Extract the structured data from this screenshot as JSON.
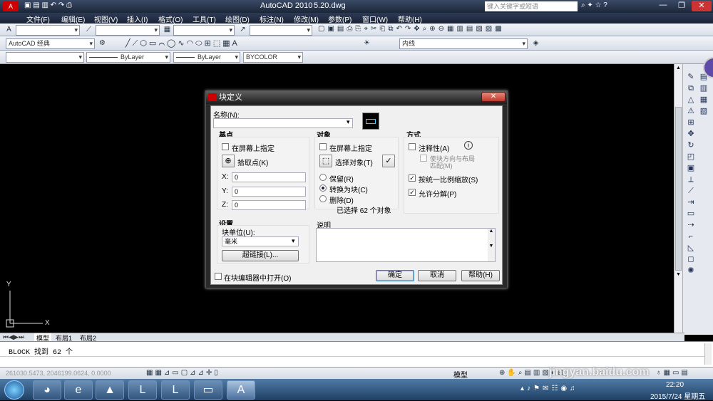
{
  "titlebar": {
    "app_title": "AutoCAD 2010",
    "file_name": "5.20.dwg",
    "search_placeholder": "键入关键字或短语",
    "minimize": "—",
    "restore": "❐",
    "close": "✕"
  },
  "menu": [
    "文件(F)",
    "编辑(E)",
    "视图(V)",
    "插入(I)",
    "格式(O)",
    "工具(T)",
    "绘图(D)",
    "标注(N)",
    "修改(M)",
    "参数(P)",
    "窗口(W)",
    "帮助(H)"
  ],
  "toolbar": {
    "workspace": "AutoCAD 经典",
    "layer": "内线",
    "color": "ByLayer",
    "linetype": "ByLayer",
    "plotstyle": "BYCOLOR"
  },
  "dialog": {
    "title": "块定义",
    "close": "✕",
    "name_label": "名称(N):",
    "name_value": "",
    "base": {
      "title": "基点",
      "specify_on_screen": "在屏幕上指定",
      "pick_point": "拾取点(K)",
      "x_label": "X:",
      "y_label": "Y:",
      "z_label": "Z:",
      "x": "0",
      "y": "0",
      "z": "0"
    },
    "objects": {
      "title": "对象",
      "specify_on_screen": "在屏幕上指定",
      "select_objects": "选择对象(T)",
      "retain": "保留(R)",
      "convert": "转换为块(C)",
      "delete": "删除(D)",
      "selected_count": "已选择 62 个对象"
    },
    "behavior": {
      "title": "方式",
      "annotative": "注释性(A)",
      "match_orientation_1": "使块方向与布局",
      "match_orientation_2": "匹配(M)",
      "scale_uniformly": "按统一比例缩放(S)",
      "allow_exploding": "允许分解(P)",
      "scale_uniformly_checked": true,
      "allow_exploding_checked": true
    },
    "settings": {
      "title": "设置",
      "block_unit_label": "块单位(U):",
      "block_unit_value": "毫米",
      "hyperlink": "超链接(L)..."
    },
    "description_label": "说明",
    "open_in_editor": "在块编辑器中打开(O)",
    "ok": "确定",
    "cancel": "取消",
    "help": "帮助(H)"
  },
  "layout_tabs": [
    "模型",
    "布局1",
    "布局2"
  ],
  "command_line": "BLOCK 找到 62 个",
  "status": {
    "coords": "261030.5473, 2046199.0624, 0.0000",
    "model": "模型"
  },
  "axis": {
    "x": "X",
    "y": "Y"
  },
  "clock": {
    "time": "22:20",
    "date": "2015/7/24 星期五"
  },
  "watermark": "jingyan.baidu.com"
}
